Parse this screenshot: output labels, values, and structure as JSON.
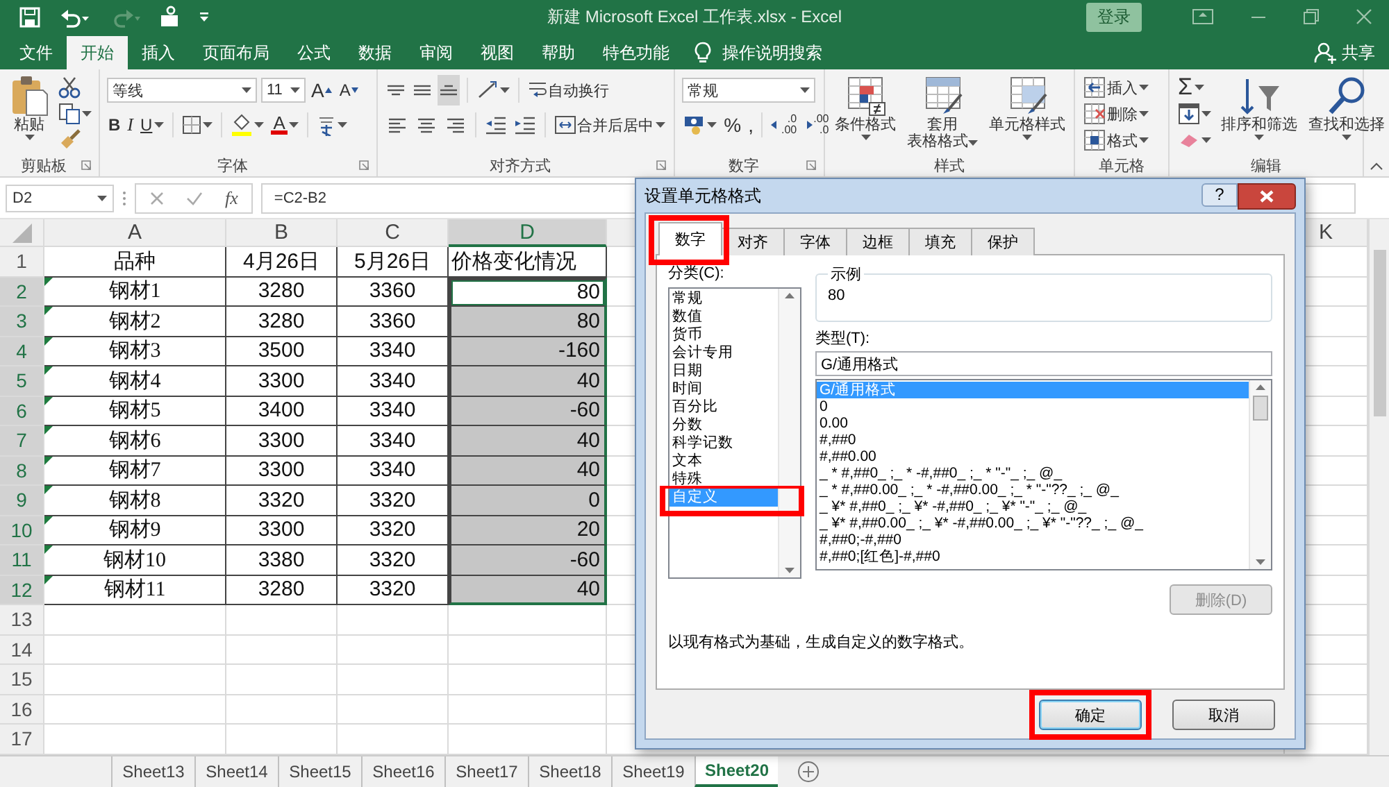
{
  "window": {
    "title": "新建 Microsoft Excel 工作表.xlsx  -  Excel",
    "login": "登录"
  },
  "menu_tabs": [
    {
      "label": "文件",
      "selected": false
    },
    {
      "label": "开始",
      "selected": true
    },
    {
      "label": "插入",
      "selected": false
    },
    {
      "label": "页面布局",
      "selected": false
    },
    {
      "label": "公式",
      "selected": false
    },
    {
      "label": "数据",
      "selected": false
    },
    {
      "label": "审阅",
      "selected": false
    },
    {
      "label": "视图",
      "selected": false
    },
    {
      "label": "帮助",
      "selected": false
    },
    {
      "label": "特色功能",
      "selected": false
    }
  ],
  "tell_me": "操作说明搜索",
  "share": "共享",
  "ribbon": {
    "clipboard": {
      "label": "剪贴板",
      "paste": "粘贴"
    },
    "font": {
      "label": "字体",
      "font_name": "等线",
      "font_size": "11",
      "grow": "A",
      "shrink": "A",
      "bold": "B",
      "italic": "I",
      "underline": "U",
      "font_color": "A"
    },
    "alignment": {
      "label": "对齐方式",
      "wrap_text": "自动换行",
      "merge_center": "合并后居中"
    },
    "number": {
      "label": "数字",
      "format": "常规",
      "percent": "%",
      "comma": ",",
      "increase_decimal": [
        ".0",
        ".00"
      ],
      "decrease_decimal": [
        ".00",
        ".0"
      ]
    },
    "styles": {
      "label": "样式",
      "conditional": "条件格式",
      "table_format": [
        "套用",
        "表格格式"
      ],
      "cell_styles": "单元格样式"
    },
    "cells": {
      "label": "单元格",
      "insert": "插入",
      "delete": "删除",
      "format": "格式"
    },
    "editing": {
      "label": "编辑",
      "sum": "Σ",
      "sort_filter": "排序和筛选",
      "find_select": "查找和选择"
    }
  },
  "formula_bar": {
    "name_box": "D2",
    "function": "fx",
    "formula": "=C2-B2"
  },
  "sheet": {
    "columns": [
      {
        "label": "A",
        "selected": false
      },
      {
        "label": "B",
        "selected": false
      },
      {
        "label": "C",
        "selected": false
      },
      {
        "label": "D",
        "selected": true
      }
    ],
    "far_column": "K",
    "rows": [
      {
        "number": "1",
        "cells": [
          "品种",
          "4月26日",
          "5月26日",
          "价格变化情况"
        ],
        "selected": false,
        "active": false,
        "error_flag": false
      },
      {
        "number": "2",
        "cells": [
          "钢材1",
          "3280",
          "3360",
          "80"
        ],
        "selected": true,
        "active": true,
        "error_flag": true
      },
      {
        "number": "3",
        "cells": [
          "钢材2",
          "3280",
          "3360",
          "80"
        ],
        "selected": true,
        "active": false,
        "error_flag": true
      },
      {
        "number": "4",
        "cells": [
          "钢材3",
          "3500",
          "3340",
          "-160"
        ],
        "selected": true,
        "active": false,
        "error_flag": true
      },
      {
        "number": "5",
        "cells": [
          "钢材4",
          "3300",
          "3340",
          "40"
        ],
        "selected": true,
        "active": false,
        "error_flag": true
      },
      {
        "number": "6",
        "cells": [
          "钢材5",
          "3400",
          "3340",
          "-60"
        ],
        "selected": true,
        "active": false,
        "error_flag": true
      },
      {
        "number": "7",
        "cells": [
          "钢材6",
          "3300",
          "3340",
          "40"
        ],
        "selected": true,
        "active": false,
        "error_flag": true
      },
      {
        "number": "8",
        "cells": [
          "钢材7",
          "3300",
          "3340",
          "40"
        ],
        "selected": true,
        "active": false,
        "error_flag": true
      },
      {
        "number": "9",
        "cells": [
          "钢材8",
          "3320",
          "3320",
          "0"
        ],
        "selected": true,
        "active": false,
        "error_flag": true
      },
      {
        "number": "10",
        "cells": [
          "钢材9",
          "3300",
          "3320",
          "20"
        ],
        "selected": true,
        "active": false,
        "error_flag": true
      },
      {
        "number": "11",
        "cells": [
          "钢材10",
          "3380",
          "3320",
          "-60"
        ],
        "selected": true,
        "active": false,
        "error_flag": true
      },
      {
        "number": "12",
        "cells": [
          "钢材11",
          "3280",
          "3320",
          "40"
        ],
        "selected": true,
        "active": false,
        "error_flag": true
      }
    ],
    "empty_rows": [
      "13",
      "14",
      "15",
      "16",
      "17"
    ]
  },
  "sheet_tabs": [
    {
      "label": "Sheet13",
      "selected": false
    },
    {
      "label": "Sheet14",
      "selected": false
    },
    {
      "label": "Sheet15",
      "selected": false
    },
    {
      "label": "Sheet16",
      "selected": false
    },
    {
      "label": "Sheet17",
      "selected": false
    },
    {
      "label": "Sheet18",
      "selected": false
    },
    {
      "label": "Sheet19",
      "selected": false
    },
    {
      "label": "Sheet20",
      "selected": true
    }
  ],
  "dialog": {
    "title": "设置单元格格式",
    "help": "?",
    "tabs": [
      {
        "label": "数字",
        "selected": true,
        "highlighted": true
      },
      {
        "label": "对齐",
        "selected": false,
        "highlighted": false
      },
      {
        "label": "字体",
        "selected": false,
        "highlighted": false
      },
      {
        "label": "边框",
        "selected": false,
        "highlighted": false
      },
      {
        "label": "填充",
        "selected": false,
        "highlighted": false
      },
      {
        "label": "保护",
        "selected": false,
        "highlighted": false
      }
    ],
    "category_label": "分类(C):",
    "categories": [
      {
        "label": "常规",
        "selected": false,
        "highlighted": false
      },
      {
        "label": "数值",
        "selected": false,
        "highlighted": false
      },
      {
        "label": "货币",
        "selected": false,
        "highlighted": false
      },
      {
        "label": "会计专用",
        "selected": false,
        "highlighted": false
      },
      {
        "label": "日期",
        "selected": false,
        "highlighted": false
      },
      {
        "label": "时间",
        "selected": false,
        "highlighted": false
      },
      {
        "label": "百分比",
        "selected": false,
        "highlighted": false
      },
      {
        "label": "分数",
        "selected": false,
        "highlighted": false
      },
      {
        "label": "科学记数",
        "selected": false,
        "highlighted": false
      },
      {
        "label": "文本",
        "selected": false,
        "highlighted": false
      },
      {
        "label": "特殊",
        "selected": false,
        "highlighted": false
      },
      {
        "label": "自定义",
        "selected": true,
        "highlighted": true
      }
    ],
    "sample_label": "示例",
    "sample_value": "80",
    "type_label": "类型(T):",
    "type_value": "G/通用格式",
    "formats": [
      {
        "label": "G/通用格式",
        "selected": true
      },
      {
        "label": "0",
        "selected": false
      },
      {
        "label": "0.00",
        "selected": false
      },
      {
        "label": "#,##0",
        "selected": false
      },
      {
        "label": "#,##0.00",
        "selected": false
      },
      {
        "label": "_ * #,##0_ ;_ * -#,##0_ ;_ * \"-\"_ ;_ @_",
        "selected": false
      },
      {
        "label": "_ * #,##0.00_ ;_ * -#,##0.00_ ;_ * \"-\"??_ ;_ @_",
        "selected": false
      },
      {
        "label": "_ ¥* #,##0_ ;_ ¥* -#,##0_ ;_ ¥* \"-\"_ ;_ @_",
        "selected": false
      },
      {
        "label": "_ ¥* #,##0.00_ ;_ ¥* -#,##0.00_ ;_ ¥* \"-\"??_ ;_ @_",
        "selected": false
      },
      {
        "label": "#,##0;-#,##0",
        "selected": false
      },
      {
        "label": "#,##0;[红色]-#,##0",
        "selected": false
      }
    ],
    "delete_button": {
      "label": "删除(D)",
      "disabled": true
    },
    "description": "以现有格式为基础，生成自定义的数字格式。",
    "buttons": [
      {
        "label": "确定",
        "kind": "default",
        "highlighted": true
      },
      {
        "label": "取消",
        "kind": "normal",
        "highlighted": false
      }
    ]
  }
}
